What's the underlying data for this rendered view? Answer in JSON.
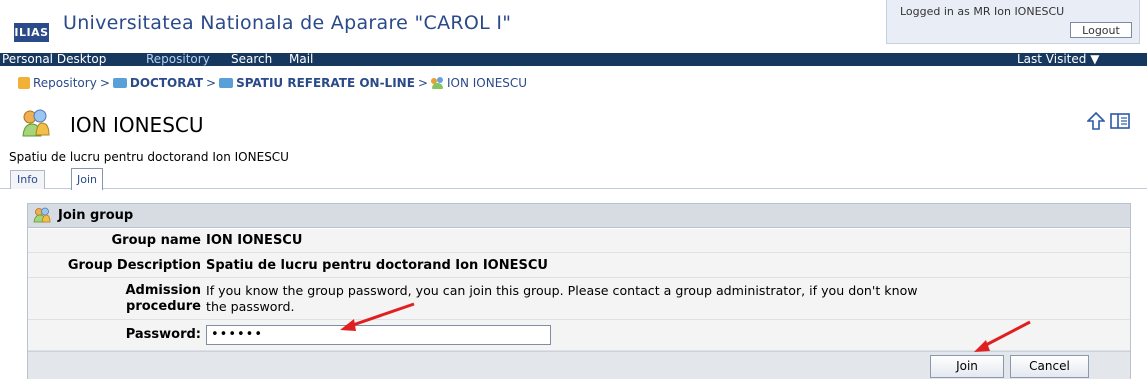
{
  "header": {
    "logo": "ILIAS",
    "site_title": "Universitatea Nationala de Aparare \"CAROL I\"",
    "login_text": "Logged in as MR Ion IONESCU",
    "logout_label": "Logout"
  },
  "nav": {
    "items": [
      "Personal Desktop",
      "Repository",
      "Search",
      "Mail"
    ],
    "last_visited": "Last Visited ▼"
  },
  "breadcrumb": [
    "Repository",
    "DOCTORAT",
    "SPATIU REFERATE ON-LINE",
    "ION IONESCU"
  ],
  "page": {
    "title": "ION IONESCU",
    "description": "Spatiu de lucru pentru doctorand Ion IONESCU"
  },
  "tabs": [
    "Info",
    "Join"
  ],
  "form": {
    "title": "Join group",
    "rows": [
      {
        "label": "Group name",
        "value": "ION IONESCU"
      },
      {
        "label": "Group Description",
        "value": "Spatiu de lucru pentru doctorand Ion IONESCU"
      }
    ],
    "admission_label_line1": "Admission",
    "admission_label_line2": "procedure",
    "admission_text_line1": "If you know the group password, you can join this group. Please contact a group administrator, if you don't know",
    "admission_text_line2": "the password.",
    "password_label": "Password:",
    "password_value": "••••••",
    "join_label": "Join",
    "cancel_label": "Cancel"
  },
  "colors": {
    "navbar": "#16375e",
    "brand": "#2a4a8a",
    "annotation_arrow": "#e02020"
  }
}
